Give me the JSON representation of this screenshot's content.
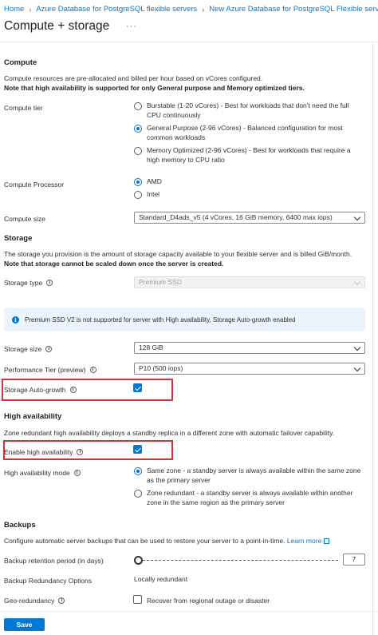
{
  "breadcrumb": [
    "Home",
    "Azure Database for PostgreSQL flexible servers",
    "New Azure Database for PostgreSQL Flexible server"
  ],
  "page": {
    "title": "Compute + storage",
    "more_label": "···"
  },
  "compute": {
    "heading": "Compute",
    "description": "Compute resources are pre-allocated and billed per hour based on vCores configured.",
    "note": "Note that high availability is supported for only General purpose and Memory optimized tiers.",
    "tier_label": "Compute tier",
    "tiers": [
      {
        "line1": "Burstable (1-20 vCores) - Best for workloads that don't need the full",
        "line2": "CPU continuously",
        "selected": false
      },
      {
        "line1": "General Purpose (2-96 vCores) - Balanced configuration for most",
        "line2": "common workloads",
        "selected": true
      },
      {
        "line1": "Memory Optimized (2-96 vCores) - Best for workloads that require a",
        "line2": "high memory to CPU ratio",
        "selected": false
      }
    ],
    "processor_label": "Compute Processor",
    "processors": [
      {
        "label": "AMD",
        "selected": true
      },
      {
        "label": "Intel",
        "selected": false
      }
    ],
    "size_label": "Compute size",
    "size_value": "Standard_D4ads_v5 (4 vCores, 16 GiB memory, 6400 max iops)"
  },
  "storage": {
    "heading": "Storage",
    "description": "The storage you provision is the amount of storage capacity available to your flexible server and is billed GiB/month.",
    "note": "Note that storage cannot be scaled down once the server is created.",
    "type_label": "Storage type",
    "type_value": "Premium SSD",
    "banner": "Premium SSD V2 is not supported for server with High availability, Storage Auto-growth enabled",
    "size_label": "Storage size",
    "size_value": "128 GiB",
    "perf_label": "Performance Tier (preview)",
    "perf_value": "P10 (500 iops)",
    "autogrowth_label": "Storage Auto-growth",
    "autogrowth_checked": true
  },
  "ha": {
    "heading": "High availability",
    "description": "Zone redundant high availability deploys a standby replica in a different zone with automatic failover capability.",
    "enable_label": "Enable high availability",
    "enable_checked": true,
    "mode_label": "High availability mode",
    "modes": [
      {
        "line1": "Same zone - a standby server is always available within the same zone",
        "line2": "as the primary server",
        "selected": true
      },
      {
        "line1": "Zone redundant - a standby server is always available within another",
        "line2": "zone in the same region as the primary server",
        "selected": false
      }
    ]
  },
  "backups": {
    "heading": "Backups",
    "description": "Configure automatic server backups that can be used to restore your server to a point-in-time.",
    "learn_more": "Learn more",
    "retention_label": "Backup retention period (in days)",
    "retention_value": "7",
    "redundancy_label": "Backup Redundancy Options",
    "redundancy_value": "Locally redundant",
    "geo_label": "Geo-redundancy",
    "geo_option": "Recover from regional outage or disaster",
    "geo_checked": false
  },
  "footer": {
    "save_label": "Save"
  },
  "colors": {
    "accent": "#0078d4",
    "highlight": "#d13438",
    "banner_bg": "#ebf3fc"
  }
}
